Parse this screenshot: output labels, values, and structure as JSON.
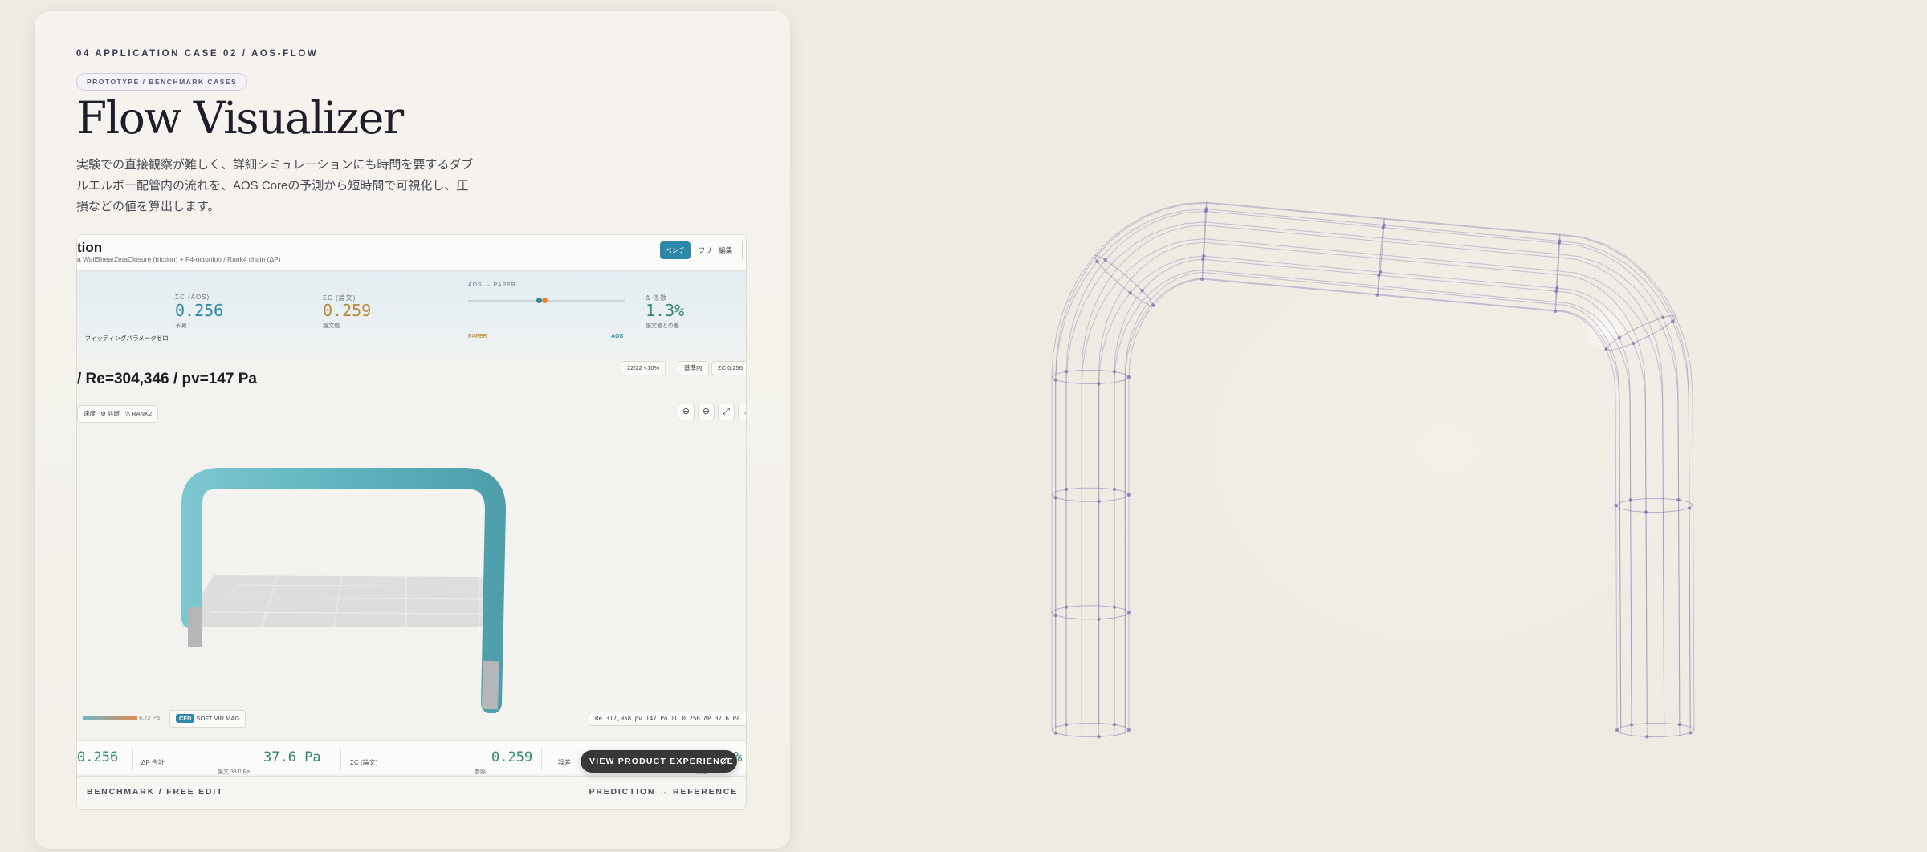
{
  "section": {
    "eyebrow": "04   APPLICATION CASE 02 / AOS-FLOW",
    "chip": "PROTOTYPE / BENCHMARK CASES",
    "title": "Flow Visualizer",
    "description": "実験での直接観察が難しく、詳細シミュレーションにも時間を要するダブルエルボー配管内の流れを、AOS Coreの予測から短時間で可視化し、圧損などの値を算出します。"
  },
  "screenshot": {
    "header": {
      "title": "tion",
      "subtitle": "a WallShearZetaClosure (friction) + F4-octonion / Rank4 chain (ΔP)",
      "mode_active": "ベンチ",
      "mode_inactive": "フリー編集"
    },
    "metrics": {
      "fit_label": "— フィッティングパラメータゼロ",
      "aos_label": "ΣC (AOS)",
      "aos_value": "0.256",
      "aos_sub": "予測",
      "paper_label": "ΣC (論文)",
      "paper_value": "0.259",
      "paper_sub": "論文値",
      "compare_label": "AOS ↔ PAPER",
      "compare_left": "PAPER",
      "compare_right": "AOS",
      "diff_label": "Δ 係数",
      "diff_value": "1.3%",
      "diff_sub": "論文値との差",
      "tag1": "22/22 <10%",
      "tag2": "基準内",
      "tag3": "ΣC 0.256"
    },
    "caption": "/ Re=304,346 / pv=147 Pa",
    "viewer_tools": {
      "speed": "速度",
      "diag": "診断",
      "rank": "RANK2"
    },
    "legend": {
      "max": "6.72 Pa",
      "modes": [
        "CFD",
        "SOFT",
        "VIR",
        "MAG"
      ],
      "readout": "Re 317,958  pv 147 Pa  ΣC 0.256  ΔP 37.6 Pa"
    },
    "bottom": {
      "v1": "0.256",
      "dp_label": "ΔP 合計",
      "dp_value": "37.6 Pa",
      "dp_sub": "論文 38.0 Pa",
      "pc_label": "ΣC (論文)",
      "pc_value": "0.259",
      "pc_sub": "参照",
      "err_label": "誤差",
      "err_value": "%",
      "err_sub": "← 誤差"
    },
    "footer_left": "BENCHMARK / FREE EDIT",
    "footer_right": "PREDICTION ↔ REFERENCE"
  },
  "cta": "VIEW PRODUCT EXPERIENCE",
  "colors": {
    "accent": "#2e87a8",
    "paper": "#b8873a",
    "good": "#2f8a6a",
    "wire": "#6b63a8"
  }
}
